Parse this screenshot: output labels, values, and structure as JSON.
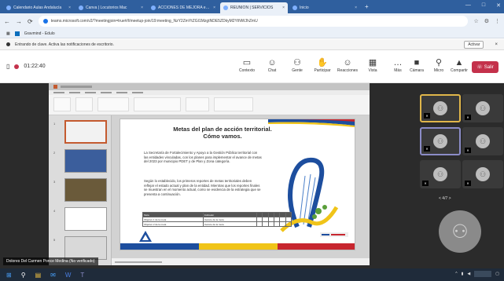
{
  "browser": {
    "tabs": [
      {
        "label": "Calendario Aulas Andalucía",
        "active": false
      },
      {
        "label": "Canva | Locutorios Mac",
        "active": false
      },
      {
        "label": "ACCIONES DE MEJORA educ",
        "active": false
      },
      {
        "label": "REUNIÓN | SERVICIOS",
        "active": true
      },
      {
        "label": "Inicio",
        "active": false
      }
    ],
    "url": "teams.microsoft.com/v2/?meetingjoin=true#/l/meetup-join/19:meeting_NzY2ZmYtZGI1MzgtNDE5ZDkyM2YtNWJhZmU",
    "bookmark": "Gravmind - Edulo",
    "nav_icons": [
      "back-icon",
      "forward-icon",
      "reload-icon"
    ]
  },
  "notification": {
    "text": "Entrando de clave. Activa las notificaciones de escritorio.",
    "action": "Activar",
    "close": "×"
  },
  "meeting": {
    "timer": "01:22:40",
    "toolbar": [
      {
        "label": "Contexto",
        "icon": "▭"
      },
      {
        "label": "Chat",
        "icon": "☺"
      },
      {
        "label": "Gente",
        "icon": "⚇"
      },
      {
        "label": "Participar",
        "icon": "✋"
      },
      {
        "label": "Reacciones",
        "icon": "☺"
      },
      {
        "label": "Vista",
        "icon": "▦"
      },
      {
        "label": "Más",
        "icon": "…"
      },
      {
        "label": "Cámara",
        "icon": "■"
      },
      {
        "label": "Micro",
        "icon": "⚲"
      },
      {
        "label": "Compartir",
        "icon": "▲"
      }
    ],
    "leave_label": "Salir",
    "presenter_caption": "Dolores Del Carmen Ponce Medina (No verificado)"
  },
  "presentation": {
    "slide": {
      "title": "Metas del plan de acción territorial.\nCómo vamos.",
      "paragraph1": "La Secretaría de Fortalecimiento y Apoyo a la Gestión Pública territorial con las entidades vinculadas, con los planes para implementar el avance de metas del 2023 por municipio PDET y de Plan y Zona categoría.",
      "paragraph2": "Según lo establecido, los primeros reportes de metas territoriales deben reflejar el estado actual y plan de la entidad. Mientras que los reportes finales se muestran en el momento actual, como se evidencia de la estrategia que se presenta a continuación.",
      "table": {
        "header": [
          "Meta",
          "Indicador",
          "",
          "",
          "",
          "",
          "",
          ""
        ],
        "rows": [
          [
            "Objetivo 1 de la meta",
            "Avance de la meta",
            "",
            "",
            "",
            "",
            "",
            ""
          ],
          [
            "Objetivo 2 de la meta",
            "Avance de la meta",
            "",
            "",
            "",
            "",
            "",
            ""
          ]
        ]
      }
    },
    "thumbnail_numbers": [
      "1",
      "2",
      "3",
      "4",
      "5"
    ]
  },
  "gallery": {
    "pager": "< 4/7 >",
    "participants": 8
  },
  "colors": {
    "leave": "#c4314b",
    "accent": "#2f5f9e",
    "highlight_yellow": "#e0b64a"
  }
}
